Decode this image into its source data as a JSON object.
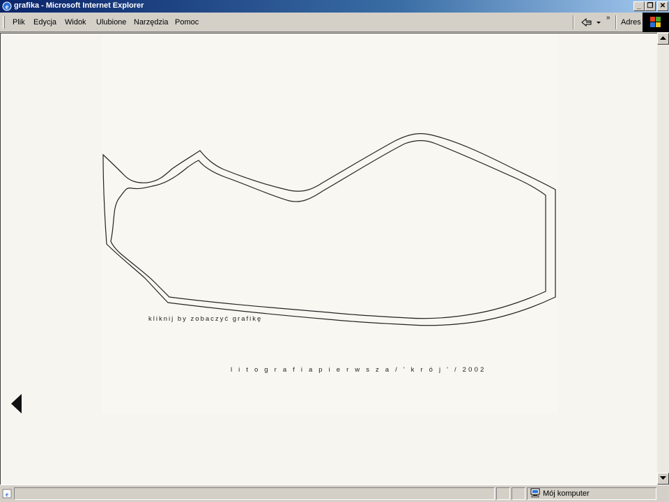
{
  "window": {
    "title": "grafika - Microsoft Internet Explorer",
    "min_glyph": "_",
    "max_glyph": "❐",
    "close_glyph": "✕"
  },
  "menu": {
    "items": [
      {
        "label": "Plik"
      },
      {
        "label": "Edycja"
      },
      {
        "label": "Widok"
      },
      {
        "label": "Ulubione"
      },
      {
        "label": "Narzędzia"
      },
      {
        "label": "Pomoc"
      }
    ],
    "overflow_glyph": "»",
    "address_label": "Adres"
  },
  "page": {
    "click_text": "kliknij by zobaczyć grafikę",
    "caption": "l i t o g r a f i a   p i e r w s z a   / ' k r ó j ' / 2002"
  },
  "status": {
    "zone_label": "Mój komputer"
  },
  "icons": [
    "ie-app-icon",
    "back-arrow-icon",
    "dropdown-arrow-icon",
    "windows-logo-icon",
    "left-arrow-icon",
    "scroll-up-icon",
    "scroll-down-icon",
    "computer-icon"
  ],
  "colors": {
    "titlebar_start": "#0a246a",
    "titlebar_end": "#a6caf0",
    "chrome": "#d4d0c8",
    "page_bg": "#f7f5f0",
    "ink": "#222222"
  }
}
